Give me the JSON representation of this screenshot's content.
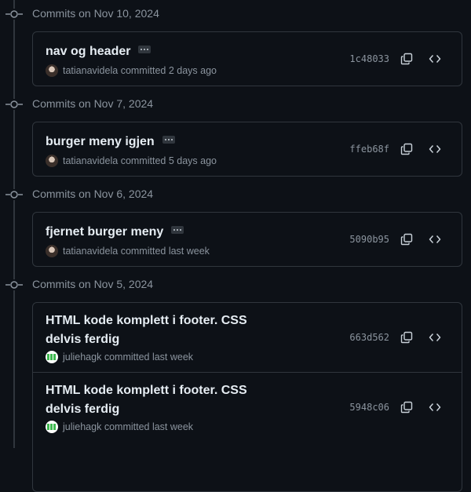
{
  "groups": [
    {
      "date": "Commits on Nov 10, 2024",
      "commits": [
        {
          "title_lines": [
            "nav og header"
          ],
          "author": "tatianavidela",
          "committed": "committed 2 days ago",
          "sha": "1c48033",
          "avatar": "tatianavidela-avatar"
        }
      ]
    },
    {
      "date": "Commits on Nov 7, 2024",
      "commits": [
        {
          "title_lines": [
            "burger meny igjen"
          ],
          "author": "tatianavidela",
          "committed": "committed 5 days ago",
          "sha": "ffeb68f",
          "avatar": "tatianavidela-avatar"
        }
      ]
    },
    {
      "date": "Commits on Nov 6, 2024",
      "commits": [
        {
          "title_lines": [
            "fjernet burger meny"
          ],
          "author": "tatianavidela",
          "committed": "committed last week",
          "sha": "5090b95",
          "avatar": "tatianavidela-avatar"
        }
      ]
    },
    {
      "date": "Commits on Nov 5, 2024",
      "commits": [
        {
          "title_lines": [
            "HTML kode komplett i footer. CSS",
            "delvis ferdig"
          ],
          "author": "juliehagk",
          "committed": "committed last week",
          "sha": "663d562",
          "avatar": "juliehagk-avatar"
        },
        {
          "title_lines": [
            "HTML kode komplett i footer. CSS",
            "delvis ferdig"
          ],
          "author": "juliehagk",
          "committed": "committed last week",
          "sha": "5948c06",
          "avatar": "juliehagk-avatar"
        }
      ]
    }
  ],
  "icons": {
    "commit": "git-commit-icon",
    "ellipsis": "ellipsis-icon",
    "copy": "copy-icon",
    "browse": "code-icon"
  },
  "colors": {
    "background": "#0d1117",
    "border": "#30363d",
    "muted_text": "#8b949e",
    "primary_text": "#e6edf3"
  }
}
